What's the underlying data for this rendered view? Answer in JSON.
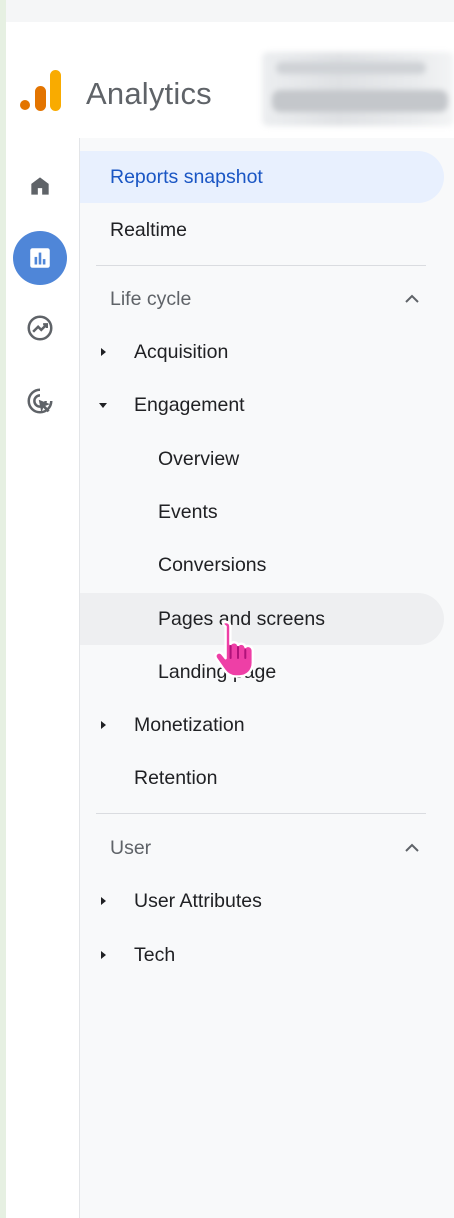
{
  "app": {
    "title": "Analytics"
  },
  "colors": {
    "accent": "#1a56c4",
    "rail_active": "#4f86d8",
    "logo_dark": "#e37400",
    "logo_light": "#f9ab00",
    "cursor": "#ee3fa6"
  },
  "rail": {
    "items": [
      {
        "name": "home",
        "icon": "home-icon",
        "active": false
      },
      {
        "name": "reports",
        "icon": "bar-chart-icon",
        "active": true
      },
      {
        "name": "explore",
        "icon": "explore-trend-icon",
        "active": false
      },
      {
        "name": "advertising",
        "icon": "ads-target-icon",
        "active": false
      }
    ]
  },
  "nav": {
    "reports_snapshot": "Reports snapshot",
    "realtime": "Realtime",
    "lifecycle": {
      "title": "Life cycle",
      "acquisition": "Acquisition",
      "engagement": "Engagement",
      "engagement_children": {
        "overview": "Overview",
        "events": "Events",
        "conversions": "Conversions",
        "pages_and_screens": "Pages and screens",
        "landing_page": "Landing page"
      },
      "monetization": "Monetization",
      "retention": "Retention"
    },
    "user": {
      "title": "User",
      "user_attributes": "User Attributes",
      "tech": "Tech"
    }
  }
}
